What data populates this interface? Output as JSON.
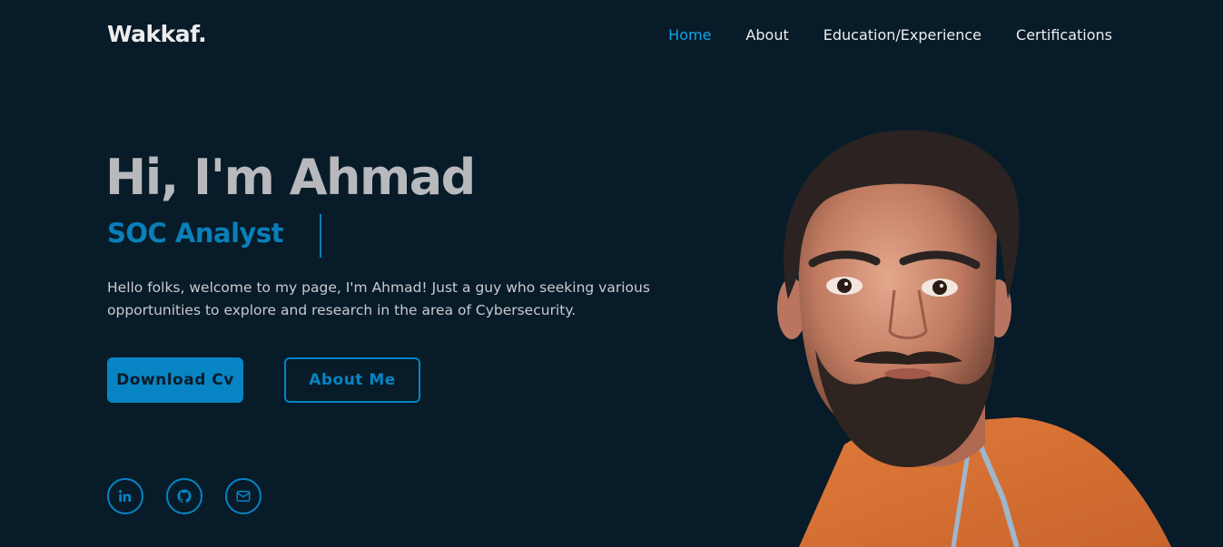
{
  "header": {
    "logo": "Wakkaf.",
    "nav": [
      {
        "label": "Home",
        "active": true
      },
      {
        "label": "About",
        "active": false
      },
      {
        "label": "Education/Experience",
        "active": false
      },
      {
        "label": "Certifications",
        "active": false
      }
    ]
  },
  "hero": {
    "title": "Hi, I'm Ahmad",
    "role": "SOC Analyst",
    "description": "Hello folks, welcome to my page, I'm Ahmad! Just a guy who seeking various opportunities to explore and research in the area of Cybersecurity.",
    "primary_button": "Download Cv",
    "secondary_button": "About Me"
  },
  "social": [
    {
      "icon": "linkedin-icon"
    },
    {
      "icon": "github-icon"
    },
    {
      "icon": "mail-icon"
    }
  ],
  "colors": {
    "background": "#081b29",
    "accent": "#0784c3",
    "nav_active": "#0ea5e9",
    "title": "#b7b9bc"
  }
}
